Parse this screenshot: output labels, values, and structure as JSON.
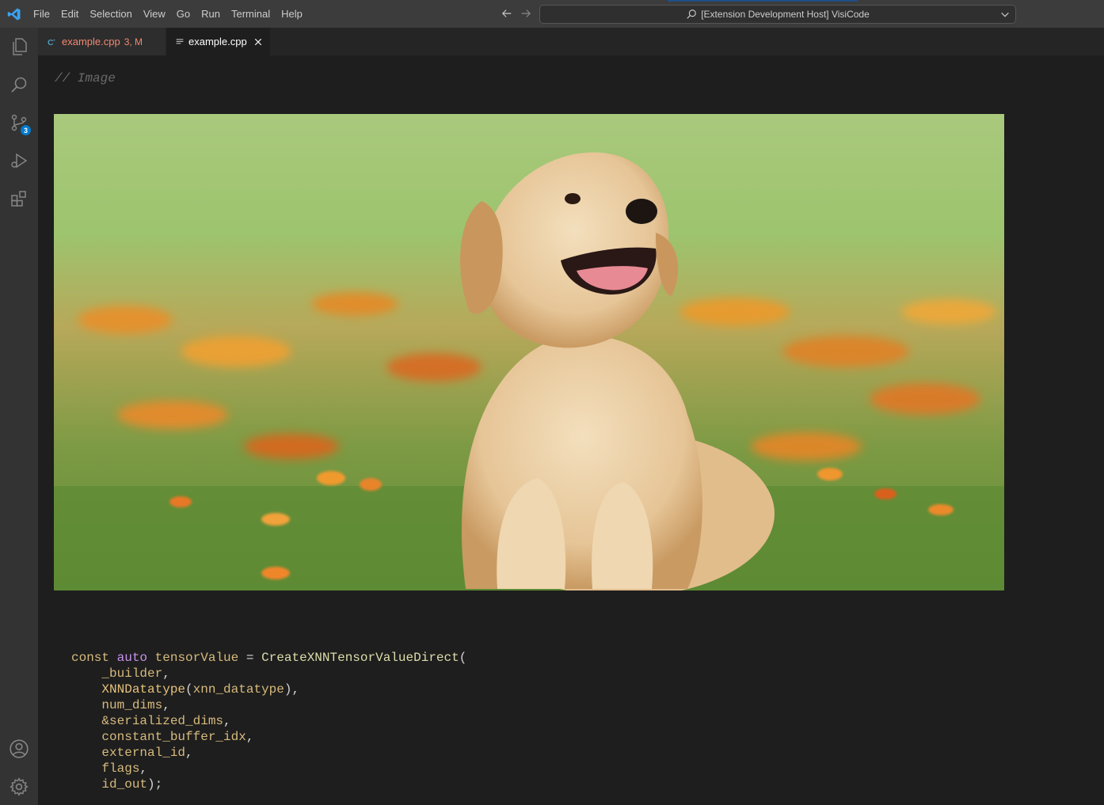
{
  "app": {
    "title": "[Extension Development Host] VisiCode",
    "brand_color": "#007acc"
  },
  "menu": [
    "File",
    "Edit",
    "Selection",
    "View",
    "Go",
    "Run",
    "Terminal",
    "Help"
  ],
  "activity_bar": {
    "items": [
      "files-icon",
      "search-icon",
      "source-control-icon",
      "run-debug-icon",
      "extensions-icon"
    ],
    "source_control_badge": "3",
    "bottom": [
      "account-icon",
      "manage-gear-icon"
    ]
  },
  "tabs": [
    {
      "label": "example.cpp",
      "badge": "3, M",
      "icon": "cpp-file-icon",
      "active": false,
      "color": "#f48771"
    },
    {
      "label": "example.cpp",
      "icon": "preview-icon",
      "active": true
    }
  ],
  "editor": {
    "comment": "// Image",
    "image_description_icon": "puppy-photo",
    "code_lines": [
      {
        "parts": [
          [
            "const",
            "kw-const"
          ],
          [
            " ",
            "pn"
          ],
          [
            "auto",
            "kw"
          ],
          [
            " ",
            "pn"
          ],
          [
            "tensorValue",
            "var"
          ],
          [
            " = ",
            "pn"
          ],
          [
            "CreateXNNTensorValueDirect",
            "fn"
          ],
          [
            "(",
            "pn"
          ]
        ]
      },
      {
        "parts": [
          [
            "    ",
            "pn"
          ],
          [
            "_builder",
            "var"
          ],
          [
            ",",
            "pn"
          ]
        ]
      },
      {
        "parts": [
          [
            "    ",
            "pn"
          ],
          [
            "XNNDatatype",
            "ty"
          ],
          [
            "(",
            "pn"
          ],
          [
            "xnn_datatype",
            "var"
          ],
          [
            "),",
            "pn"
          ]
        ]
      },
      {
        "parts": [
          [
            "    ",
            "pn"
          ],
          [
            "num_dims",
            "var"
          ],
          [
            ",",
            "pn"
          ]
        ]
      },
      {
        "parts": [
          [
            "    ",
            "pn"
          ],
          [
            "&serialized_dims",
            "var"
          ],
          [
            ",",
            "pn"
          ]
        ]
      },
      {
        "parts": [
          [
            "    ",
            "pn"
          ],
          [
            "constant_buffer_idx",
            "var"
          ],
          [
            ",",
            "pn"
          ]
        ]
      },
      {
        "parts": [
          [
            "    ",
            "pn"
          ],
          [
            "external_id",
            "var"
          ],
          [
            ",",
            "pn"
          ]
        ]
      },
      {
        "parts": [
          [
            "    ",
            "pn"
          ],
          [
            "flags",
            "var"
          ],
          [
            ",",
            "pn"
          ]
        ]
      },
      {
        "parts": [
          [
            "    ",
            "pn"
          ],
          [
            "id_out",
            "var"
          ],
          [
            ");",
            "pn"
          ]
        ]
      }
    ]
  }
}
